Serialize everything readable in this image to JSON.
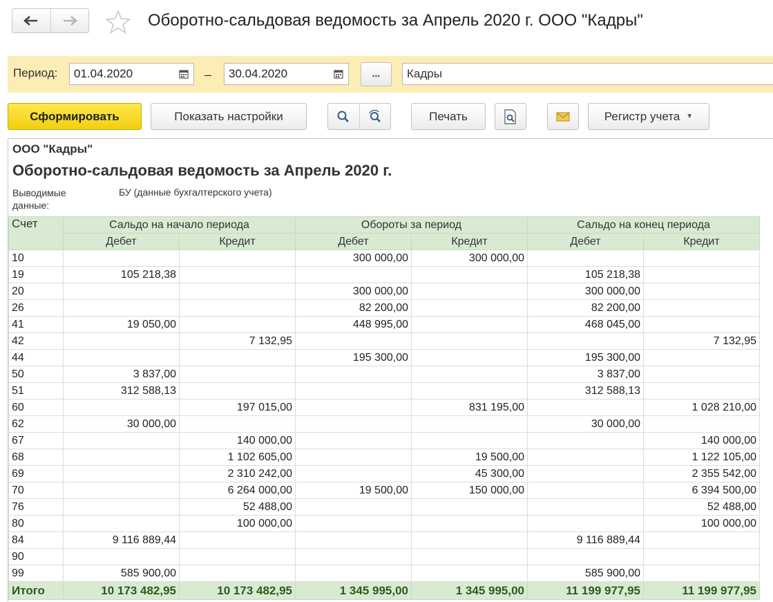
{
  "window": {
    "title": "Оборотно-сальдовая ведомость за Апрель 2020 г. ООО \"Кадры\""
  },
  "nav": {
    "back_icon": "arrow-left-icon",
    "forward_icon": "arrow-right-icon",
    "favorite_icon": "star-icon"
  },
  "period": {
    "label": "Период:",
    "start": "01.04.2020",
    "dash": "–",
    "end": "30.04.2020",
    "select_label": "...",
    "organization": "Кадры"
  },
  "toolbar": {
    "generate_label": "Сформировать",
    "settings_label": "Показать настройки",
    "print_label": "Печать",
    "register_label": "Регистр учета",
    "colors": {
      "primary": "#f5d314",
      "period_bar": "#fbedb3",
      "header_bg": "#d9ead3",
      "total_text": "#2e5a1c"
    }
  },
  "report": {
    "organization": "ООО \"Кадры\"",
    "title": "Оборотно-сальдовая ведомость за Апрель 2020 г.",
    "param_label": "Выводимые данные:",
    "param_value": "БУ (данные бухгалтерского учета)",
    "columns": {
      "account": "Счет",
      "opening": "Сальдо на начало периода",
      "turnover": "Обороты за период",
      "closing": "Сальдо на конец периода",
      "debit": "Дебет",
      "credit": "Кредит"
    },
    "rows": [
      [
        "10",
        "",
        "",
        "300 000,00",
        "300 000,00",
        "",
        ""
      ],
      [
        "19",
        "105 218,38",
        "",
        "",
        "",
        "105 218,38",
        ""
      ],
      [
        "20",
        "",
        "",
        "300 000,00",
        "",
        "300 000,00",
        ""
      ],
      [
        "26",
        "",
        "",
        "82 200,00",
        "",
        "82 200,00",
        ""
      ],
      [
        "41",
        "19 050,00",
        "",
        "448 995,00",
        "",
        "468 045,00",
        ""
      ],
      [
        "42",
        "",
        "7 132,95",
        "",
        "",
        "",
        "7 132,95"
      ],
      [
        "44",
        "",
        "",
        "195 300,00",
        "",
        "195 300,00",
        ""
      ],
      [
        "50",
        "3 837,00",
        "",
        "",
        "",
        "3 837,00",
        ""
      ],
      [
        "51",
        "312 588,13",
        "",
        "",
        "",
        "312 588,13",
        ""
      ],
      [
        "60",
        "",
        "197 015,00",
        "",
        "831 195,00",
        "",
        "1 028 210,00"
      ],
      [
        "62",
        "30 000,00",
        "",
        "",
        "",
        "30 000,00",
        ""
      ],
      [
        "67",
        "",
        "140 000,00",
        "",
        "",
        "",
        "140 000,00"
      ],
      [
        "68",
        "",
        "1 102 605,00",
        "",
        "19 500,00",
        "",
        "1 122 105,00"
      ],
      [
        "69",
        "",
        "2 310 242,00",
        "",
        "45 300,00",
        "",
        "2 355 542,00"
      ],
      [
        "70",
        "",
        "6 264 000,00",
        "19 500,00",
        "150 000,00",
        "",
        "6 394 500,00"
      ],
      [
        "76",
        "",
        "52 488,00",
        "",
        "",
        "",
        "52 488,00"
      ],
      [
        "80",
        "",
        "100 000,00",
        "",
        "",
        "",
        "100 000,00"
      ],
      [
        "84",
        "9 116 889,44",
        "",
        "",
        "",
        "9 116 889,44",
        ""
      ],
      [
        "90",
        "",
        "",
        "",
        "",
        "",
        ""
      ],
      [
        "99",
        "585 900,00",
        "",
        "",
        "",
        "585 900,00",
        ""
      ]
    ],
    "total": [
      "Итого",
      "10 173 482,95",
      "10 173 482,95",
      "1 345 995,00",
      "1 345 995,00",
      "11 199 977,95",
      "11 199 977,95"
    ]
  }
}
